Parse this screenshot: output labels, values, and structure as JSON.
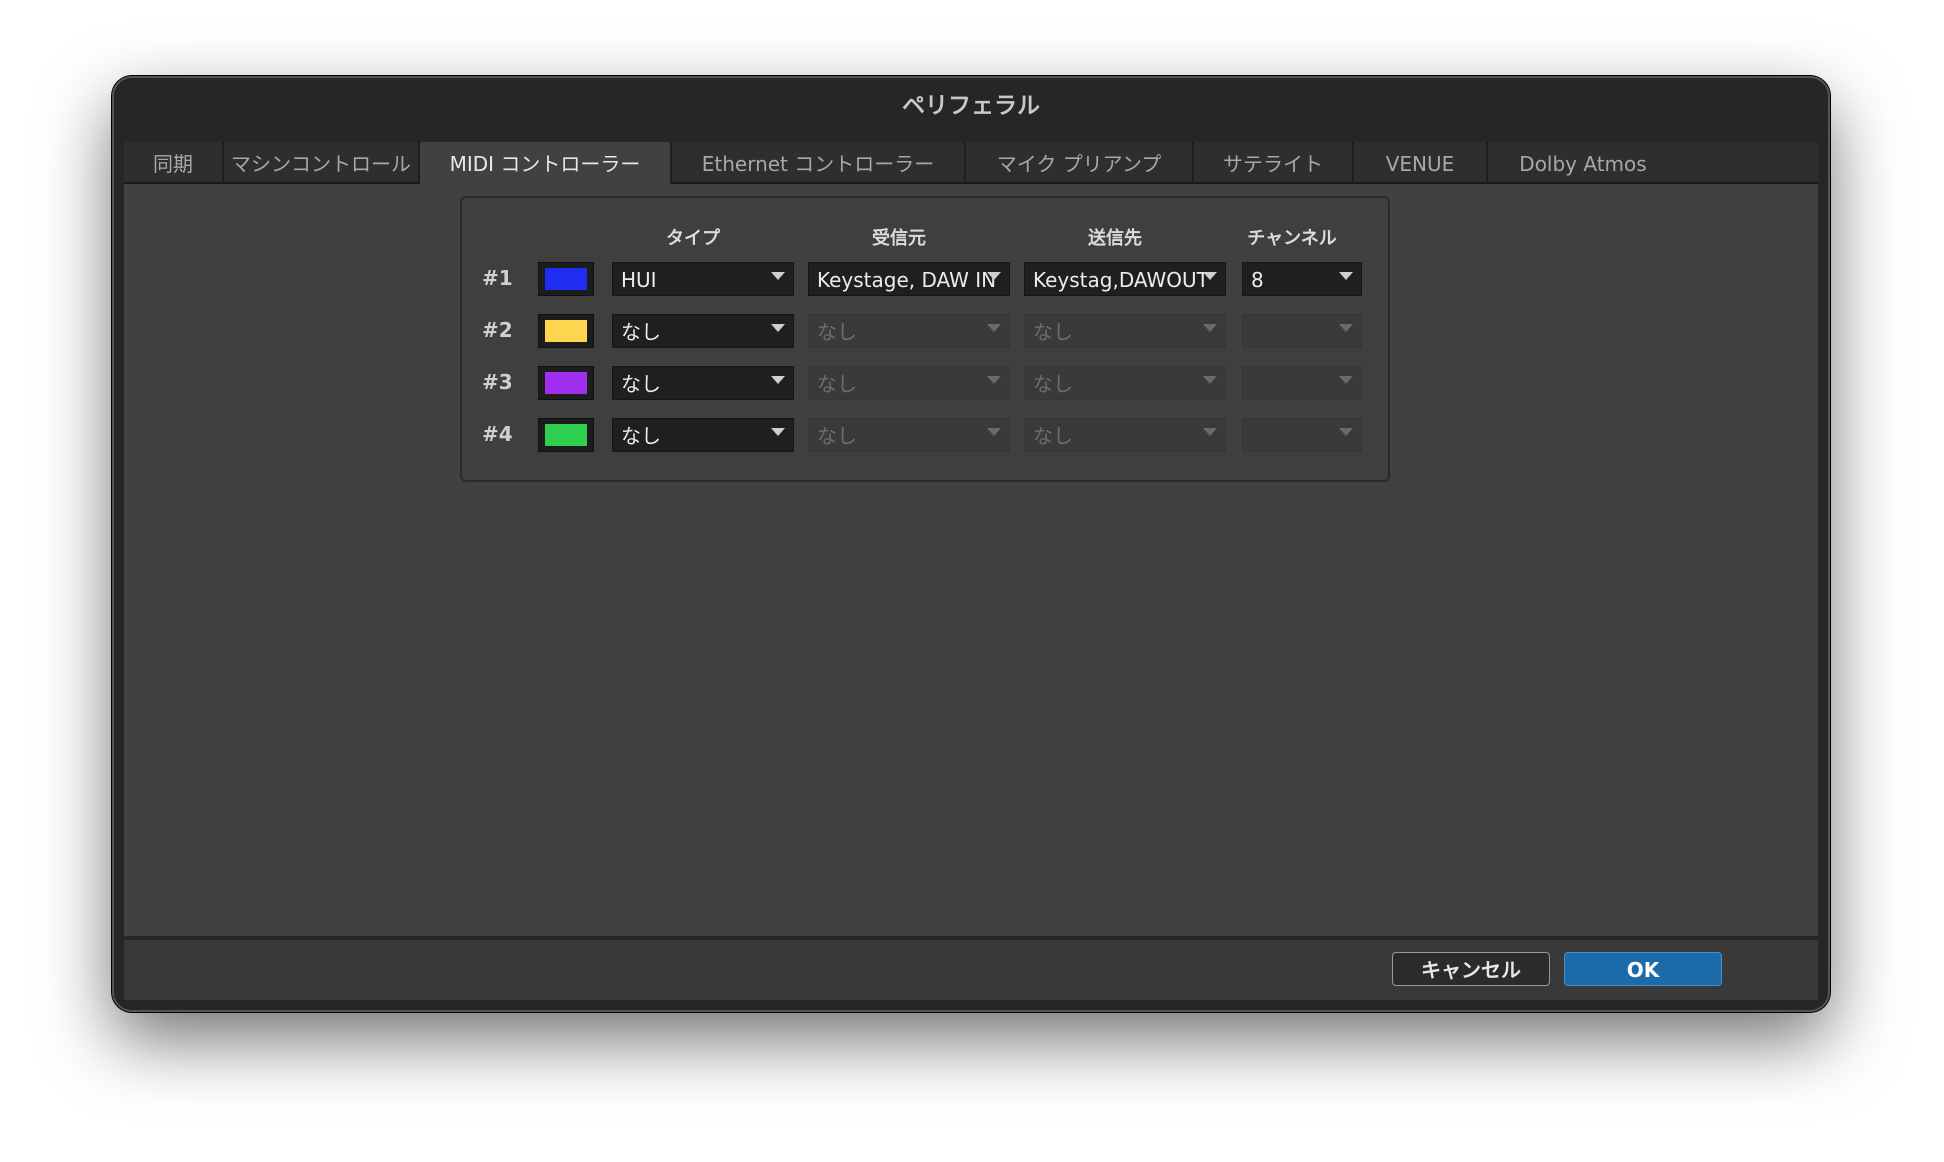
{
  "window": {
    "title": "ペリフェラル"
  },
  "tabs": [
    {
      "label": "同期"
    },
    {
      "label": "マシンコントロール"
    },
    {
      "label": "MIDI コントローラー"
    },
    {
      "label": "Ethernet コントローラー"
    },
    {
      "label": "マイク プリアンプ"
    },
    {
      "label": "サテライト"
    },
    {
      "label": "VENUE"
    },
    {
      "label": "Dolby Atmos"
    }
  ],
  "active_tab": "MIDI コントローラー",
  "columns": {
    "type": "タイプ",
    "receive_from": "受信元",
    "send_to": "送信先",
    "channel": "チャンネル"
  },
  "rows": [
    {
      "num": "#1",
      "color": "#1f2cf2",
      "type": "HUI",
      "receive_from": "Keystage, DAW IN",
      "send_to": "Keystag,DAWOUT",
      "channel": "8",
      "enabled": true
    },
    {
      "num": "#2",
      "color": "#fdd54f",
      "type": "なし",
      "receive_from": "なし",
      "send_to": "なし",
      "channel": "",
      "enabled": false
    },
    {
      "num": "#3",
      "color": "#a02ff0",
      "type": "なし",
      "receive_from": "なし",
      "send_to": "なし",
      "channel": "",
      "enabled": false
    },
    {
      "num": "#4",
      "color": "#2fd04f",
      "type": "なし",
      "receive_from": "なし",
      "send_to": "なし",
      "channel": "",
      "enabled": false
    }
  ],
  "buttons": {
    "cancel": "キャンセル",
    "ok": "OK"
  }
}
